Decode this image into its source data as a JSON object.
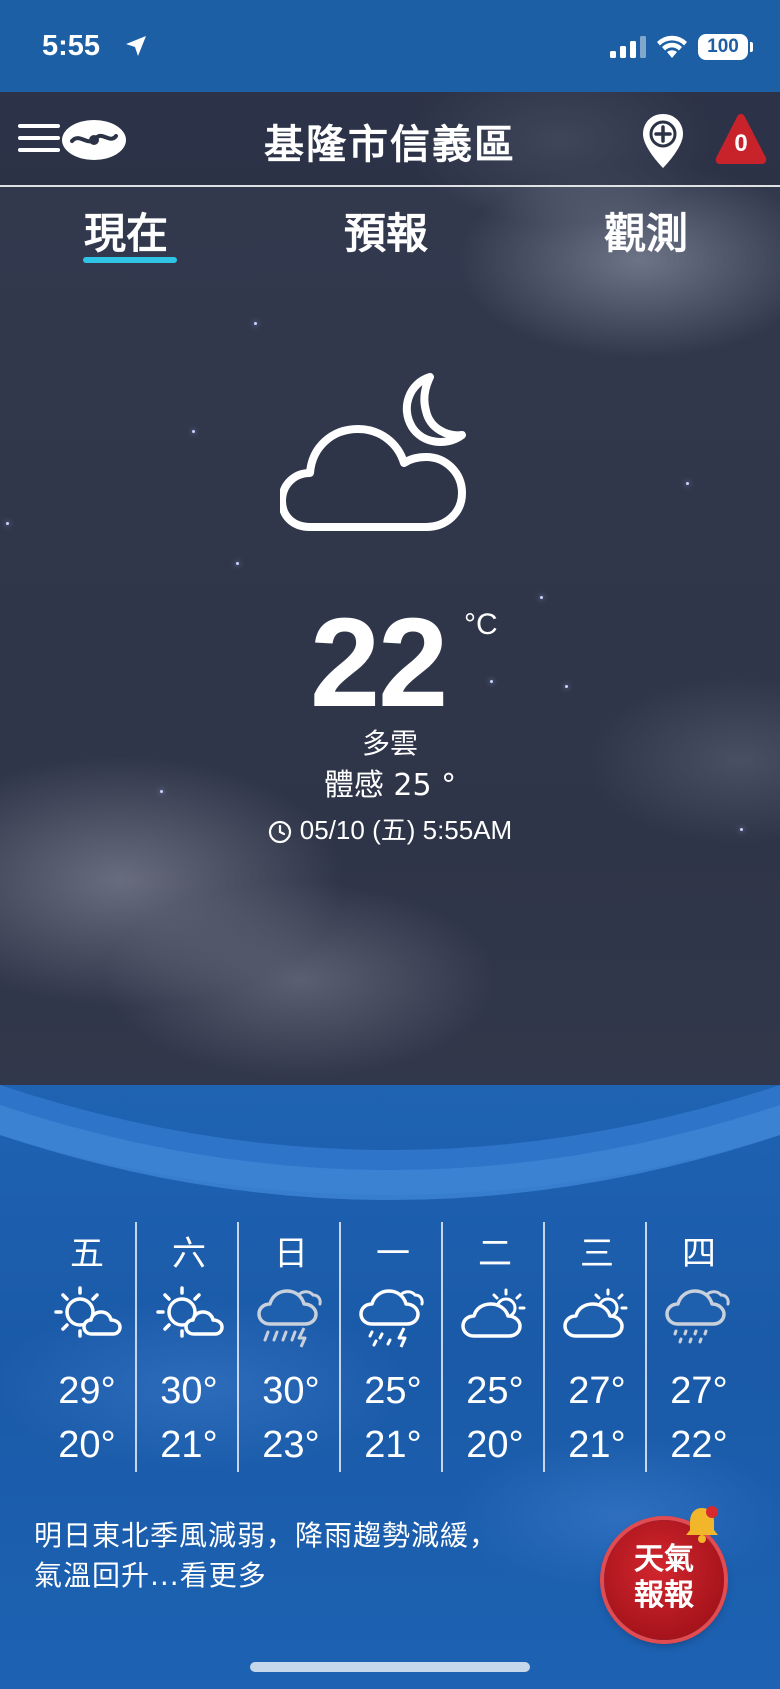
{
  "status_bar": {
    "time": "5:55",
    "battery": "100"
  },
  "header": {
    "location": "基隆市信義區",
    "alert_count": "0"
  },
  "tabs": [
    {
      "label": "現在",
      "active": true
    },
    {
      "label": "預報",
      "active": false
    },
    {
      "label": "觀測",
      "active": false
    }
  ],
  "current": {
    "icon": "partly-cloudy-night-icon",
    "temperature": "22",
    "unit": "°C",
    "condition": "多雲",
    "feels_like": "體感 25 °",
    "observed_at": "05/10 (五) 5:55AM"
  },
  "forecast": [
    {
      "day": "五",
      "icon": "sun-cloud-icon",
      "high": "29°",
      "low": "20°"
    },
    {
      "day": "六",
      "icon": "sun-cloud-icon",
      "high": "30°",
      "low": "21°"
    },
    {
      "day": "日",
      "icon": "cloud-thunder-rain-icon",
      "high": "30°",
      "low": "23°"
    },
    {
      "day": "一",
      "icon": "cloud-thunder-rain-icon",
      "high": "25°",
      "low": "21°"
    },
    {
      "day": "二",
      "icon": "cloud-sun-icon",
      "high": "25°",
      "low": "20°"
    },
    {
      "day": "三",
      "icon": "cloud-sun-icon",
      "high": "27°",
      "low": "21°"
    },
    {
      "day": "四",
      "icon": "cloud-rain-icon",
      "high": "27°",
      "low": "22°"
    }
  ],
  "summary": {
    "line1": "明日東北季風減弱，降雨趨勢減緩，",
    "line2": "氣溫回升...看更多"
  },
  "news_badge": {
    "line1": "天氣",
    "line2": "報報"
  },
  "colors": {
    "status_bar": "#1c5fa5",
    "tab_indicator": "#2fc3e6",
    "panel_blue": "#1a5aa8",
    "badge_red": "#c81e26"
  }
}
